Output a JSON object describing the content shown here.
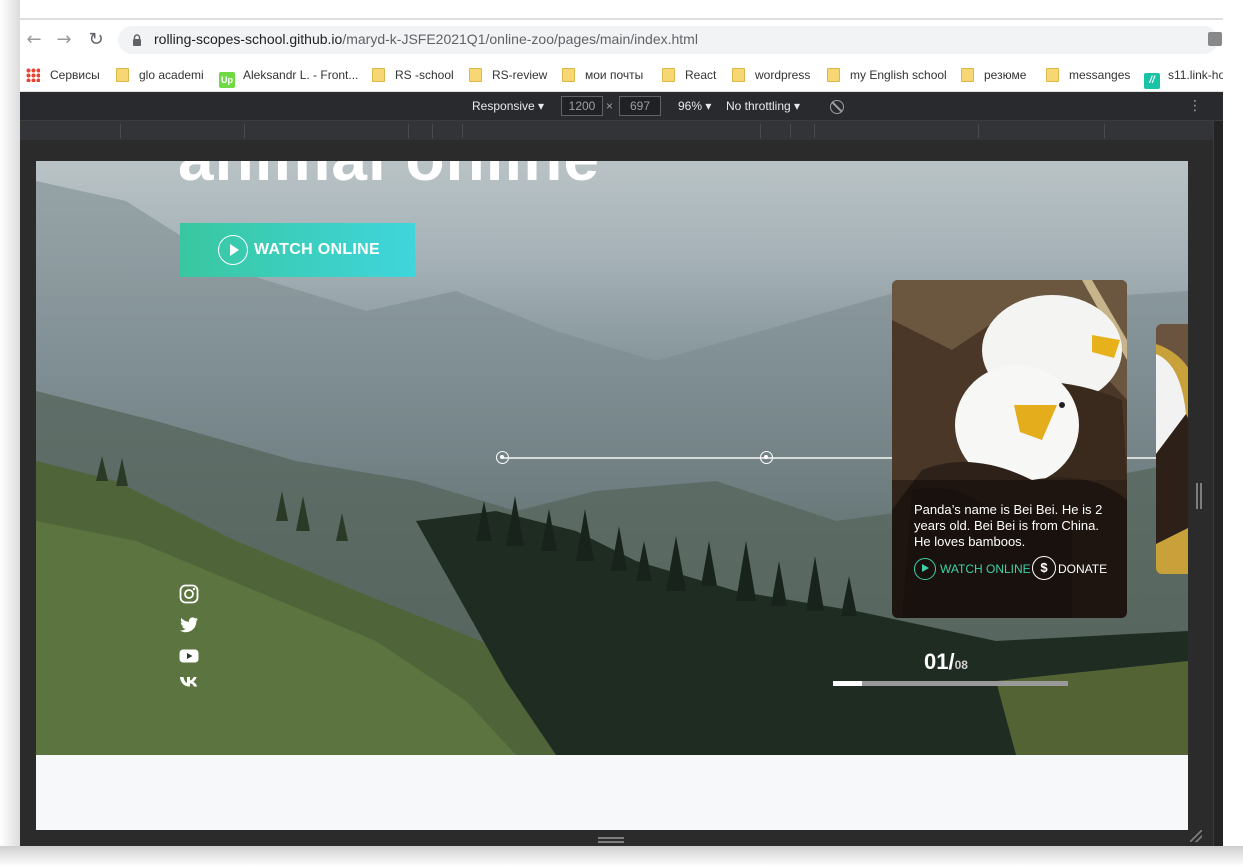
{
  "browser": {
    "url_host": "rolling-scopes-school.github.io",
    "url_path": "/maryd-k-JSFE2021Q1/online-zoo/pages/main/index.html"
  },
  "bookmarks": [
    {
      "label": "Сервисы",
      "icon": "apps-grid-icon"
    },
    {
      "label": "glo academi",
      "icon": "folder-icon"
    },
    {
      "label": "Aleksandr L. - Front...",
      "icon": "upwork-icon"
    },
    {
      "label": "RS -school",
      "icon": "folder-icon"
    },
    {
      "label": "RS-review",
      "icon": "folder-icon"
    },
    {
      "label": "мои почты",
      "icon": "folder-icon"
    },
    {
      "label": "React",
      "icon": "folder-icon"
    },
    {
      "label": "wordpress",
      "icon": "folder-icon"
    },
    {
      "label": "my English school",
      "icon": "folder-icon"
    },
    {
      "label": "резюме",
      "icon": "folder-icon"
    },
    {
      "label": "messanges",
      "icon": "folder-icon"
    },
    {
      "label": "s11.link-ho",
      "icon": "link-icon"
    }
  ],
  "devtools": {
    "device": "Responsive",
    "width": "1200",
    "times": "×",
    "height": "697",
    "zoom": "96%",
    "throttle": "No throttling"
  },
  "hero": {
    "title_fragment": "animal online",
    "watch_button": "WATCH ONLINE",
    "card": {
      "text": "Panda’s name is Bei Bei. He is 2 years old. Bei Bei is from China. He loves bamboos.",
      "watch_label": "WATCH ONLINE",
      "donate_icon_glyph": "$",
      "donate_label": "DONATE"
    },
    "counter_current": "01/",
    "counter_total": "08",
    "progress_fraction": 0.125
  },
  "socials": [
    "instagram-icon",
    "twitter-icon",
    "youtube-icon",
    "vk-icon"
  ],
  "colors": {
    "accent_start": "#39c7a0",
    "accent_end": "#3fd5dc",
    "devtools_bg": "#292a2d"
  }
}
